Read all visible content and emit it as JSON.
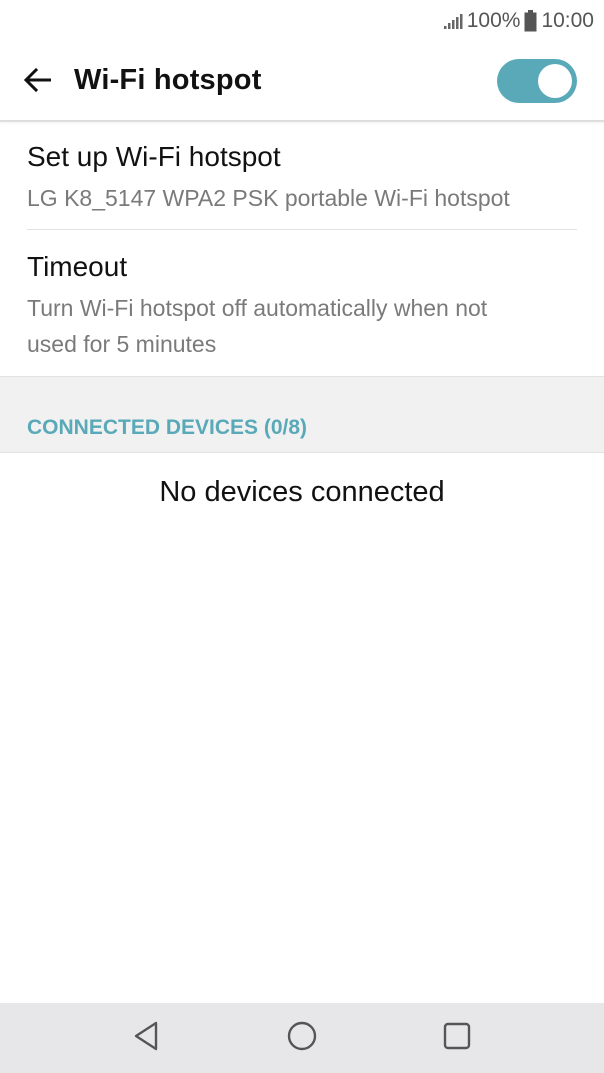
{
  "status_bar": {
    "battery_text": "100%",
    "time": "10:00",
    "signal_icon": "signal-bars-icon",
    "battery_icon": "battery-full-icon"
  },
  "header": {
    "title": "Wi-Fi hotspot",
    "back_icon": "arrow-left-icon",
    "toggle_on": true
  },
  "settings": {
    "items": [
      {
        "title": "Set up Wi-Fi hotspot",
        "summary": "LG K8_5147 WPA2 PSK portable Wi-Fi hotspot"
      },
      {
        "title": "Timeout",
        "summary_line1": "Turn Wi-Fi hotspot off automatically when not",
        "summary_line2": "used for 5 minutes"
      }
    ]
  },
  "connected_devices": {
    "header": "CONNECTED DEVICES (0/8)",
    "empty_message": "No devices connected"
  },
  "nav_bar": {
    "back_icon": "nav-back-triangle-icon",
    "home_icon": "nav-home-circle-icon",
    "recents_icon": "nav-recents-square-icon"
  },
  "colors": {
    "accent": "#5aa9b8",
    "secondary_text": "#7a7a7a",
    "nav_bar_bg": "#e7e7e9",
    "section_bg": "#f1f1f1"
  }
}
